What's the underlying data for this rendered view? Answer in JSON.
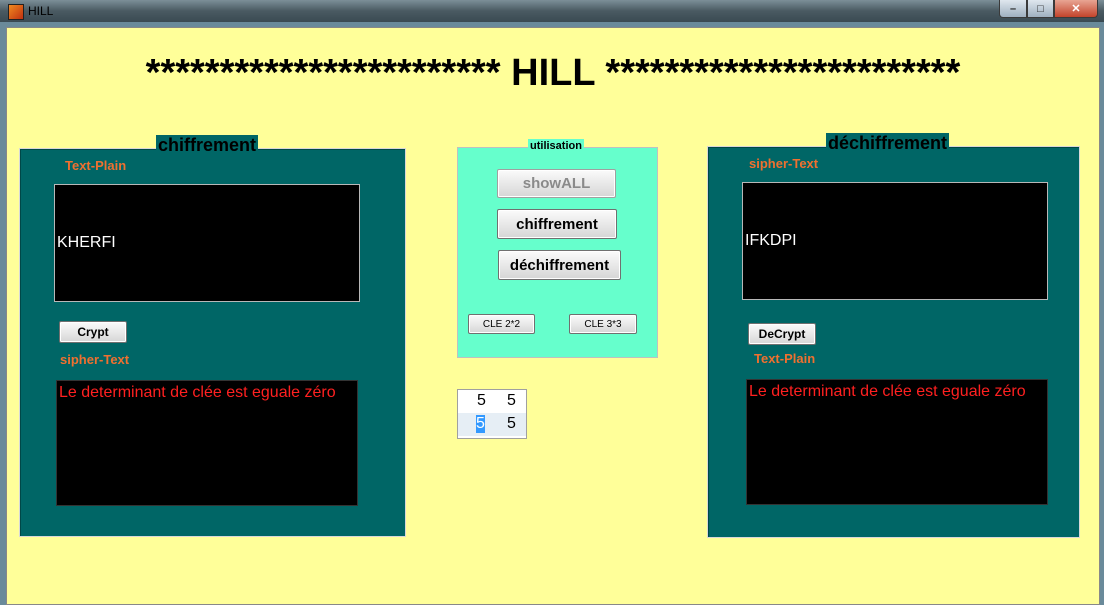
{
  "window": {
    "title": "HILL"
  },
  "heading": "************************ HILL ************************",
  "encrypt_panel": {
    "title": "chiffrement",
    "plain_label": "Text-Plain",
    "plain_value": "KHERFI",
    "crypt_button": "Crypt",
    "cipher_label": "sipher-Text",
    "cipher_value": "Le determinant de clée est eguale zéro"
  },
  "usage_panel": {
    "title": "utilisation",
    "showall_button": "showALL",
    "encrypt_button": "chiffrement",
    "decrypt_button": "déchiffrement",
    "key2_button": "CLE 2*2",
    "key3_button": "CLE 3*3"
  },
  "key_matrix": [
    [
      "5",
      "5"
    ],
    [
      "5",
      "5"
    ]
  ],
  "decrypt_panel": {
    "title": "déchiffrement",
    "cipher_label": "sipher-Text",
    "cipher_value": "IFKDPI",
    "decrypt_button": "DeCrypt",
    "plain_label": "Text-Plain",
    "plain_value": "Le determinant de clée est eguale zéro"
  },
  "colors": {
    "background": "#ffff99",
    "panel": "#006666",
    "usage_panel": "#66ffcc",
    "label": "#f07030",
    "error_text": "#ff2020"
  }
}
